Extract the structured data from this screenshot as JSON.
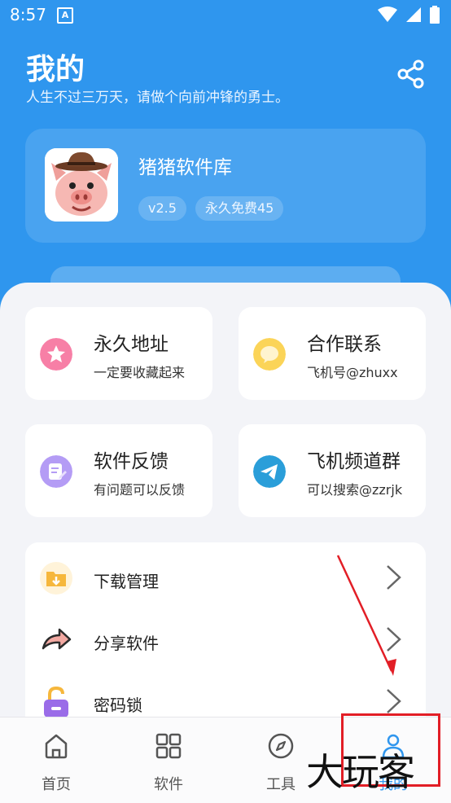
{
  "status_bar": {
    "time": "8:57",
    "notification_letter": "A"
  },
  "header": {
    "title": "我的",
    "subtitle": "人生不过三万天，请做个向前冲锋的勇士。"
  },
  "profile": {
    "app_name": "猪猪软件库",
    "version": "v2.5",
    "license": "永久免费45"
  },
  "grid_cards": [
    {
      "title": "永久地址",
      "subtitle": "一定要收藏起来",
      "icon": "star-icon"
    },
    {
      "title": "合作联系",
      "subtitle": "飞机号@zhuxx",
      "icon": "chat-icon"
    },
    {
      "title": "软件反馈",
      "subtitle": "有问题可以反馈",
      "icon": "feedback-icon"
    },
    {
      "title": "飞机频道群",
      "subtitle": "可以搜索@zzrjk",
      "icon": "telegram-icon"
    }
  ],
  "menu_list": [
    {
      "label": "下载管理",
      "icon": "download-folder-icon"
    },
    {
      "label": "分享软件",
      "icon": "share-arrow-icon"
    },
    {
      "label": "密码锁",
      "icon": "lock-icon"
    }
  ],
  "bottom_nav": [
    {
      "label": "首页",
      "icon": "home-icon"
    },
    {
      "label": "软件",
      "icon": "apps-grid-icon"
    },
    {
      "label": "工具",
      "icon": "compass-icon"
    },
    {
      "label": "我的",
      "icon": "user-icon",
      "active": true
    }
  ],
  "watermark": "大玩客",
  "colors": {
    "primary": "#2f96ee",
    "annotation": "#e21e26"
  }
}
